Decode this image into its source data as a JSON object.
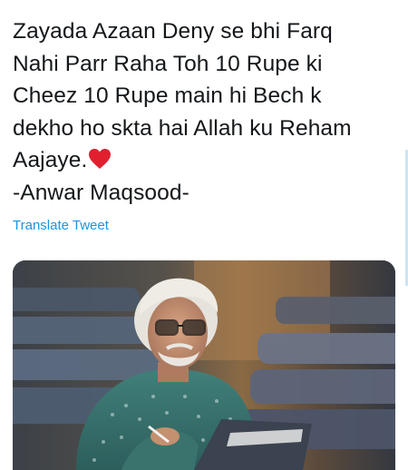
{
  "tweet": {
    "lines": [
      "Zayada Azaan Deny se bhi Farq",
      "Nahi Parr Raha Toh 10 Rupe ki",
      "Cheez 10 Rupe main hi Bech k",
      "dekho ho skta hai Allah ku Reham",
      "Aajaye.",
      "-Anwar Maqsood-"
    ],
    "emoji": "heart-icon",
    "translate_label": "Translate Tweet",
    "link_color": "#1b95e0",
    "text_color": "#14171a"
  },
  "media": {
    "icon": "photo-elderly-man-writing"
  }
}
